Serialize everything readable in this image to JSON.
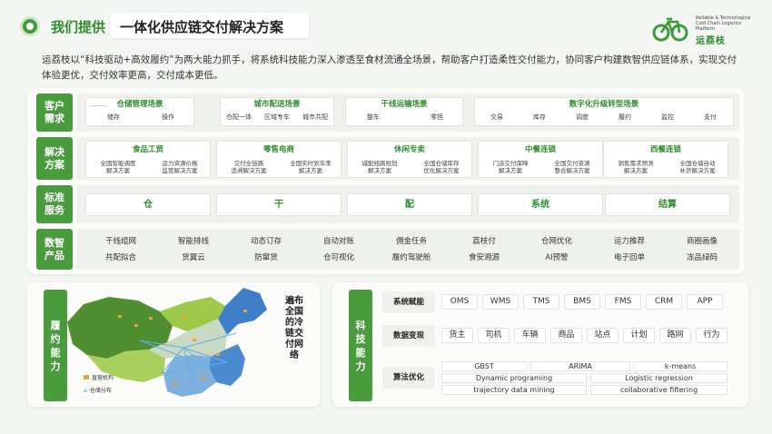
{
  "header": {
    "title_green": "我们提供",
    "title_dark": "一体化供应链交付解决方案",
    "logo_en": "Reliable & Technological Cold Chain Logistics Platform",
    "logo_cn": "运荔枝"
  },
  "intro": "运荔枝以“科技驱动+高效履约”为两大能力抓手，将系统科技能力深入渗透至食材流通全场景，帮助客户打造柔性交付能力，协同客户构建数智供应链体系，实现交付体验更优，交付效率更高，交付成本更低。",
  "rows": {
    "customer": "客户需求",
    "solution": "解决方案",
    "standard": "标准服务",
    "digital": "数智产品"
  },
  "scenarios": [
    {
      "title": "仓储管理场景",
      "items": [
        "储存",
        "操作"
      ]
    },
    {
      "title": "城市配送场景",
      "items": [
        "仓配一体",
        "区域专车",
        "城市共配"
      ]
    },
    {
      "title": "干线运输场景",
      "items": [
        "整车",
        "零担"
      ]
    },
    {
      "title": "数字化升级转型场景",
      "items": [
        "交易",
        "库存",
        "调度",
        "履约",
        "监控",
        "支付"
      ]
    }
  ],
  "solutions": [
    {
      "title": "食品工贸",
      "items": [
        "全国智能调度\n解决方案",
        "运力资源价格\n监管解决方案"
      ]
    },
    {
      "title": "零售电商",
      "items": [
        "交付全链路\n追溯解决方案",
        "全国实时到车率\n解决方案"
      ]
    },
    {
      "title": "休闲专卖",
      "items": [
        "城配线路规划\n解决方案",
        "全国仓储库存\n优化解决方案"
      ]
    },
    {
      "title": "中餐连锁",
      "items": [
        "门店交付保障\n解决方案",
        "全国交付资源\n整合解决方案"
      ]
    },
    {
      "title": "西餐连锁",
      "items": [
        "销售需求预测\n解决方案",
        "全国仓储自动\n补货解决方案"
      ]
    }
  ],
  "standard_services": [
    "仓",
    "干",
    "配",
    "系统",
    "结算"
  ],
  "digital_products": [
    [
      "干线组网",
      "智能排线",
      "动态订存",
      "自动对账",
      "佣金任务",
      "荔枝付",
      "仓网优化",
      "运力推荐",
      "商圈画像"
    ],
    [
      "共配拟合",
      "货翼云",
      "防窜货",
      "仓可视化",
      "履约驾驶舱",
      "食安溯源",
      "AI预警",
      "电子回单",
      "冻品绿码"
    ]
  ],
  "fulfillment": {
    "label": "履约能力",
    "map_title": "遍布全国的冷链交付网络",
    "legend": [
      {
        "label": "直营机构"
      },
      {
        "label": "仓储分布"
      }
    ]
  },
  "tech": {
    "label": "科技能力",
    "rows": [
      {
        "label": "系统赋能",
        "items": [
          "OMS",
          "WMS",
          "TMS",
          "BMS",
          "FMS",
          "CRM",
          "APP"
        ]
      },
      {
        "label": "数据变现",
        "items": [
          "货主",
          "司机",
          "车辆",
          "商品",
          "站点",
          "计划",
          "路网",
          "行为"
        ]
      },
      {
        "label": "算法优化",
        "items": [
          "GBST",
          "ARIMA",
          "k-means",
          "Dynamic programing",
          "Logistic regression",
          "trajectory data mining",
          "collaborative filtering"
        ]
      }
    ]
  },
  "colors": {
    "brand_green": "#2f8c2e",
    "label_green": "#4a9a3e",
    "map_dark_green": "#4f8f32",
    "map_light_green": "#9cc94a",
    "map_blue": "#3f7fc9",
    "flow_blue": "#5fb0e8"
  }
}
